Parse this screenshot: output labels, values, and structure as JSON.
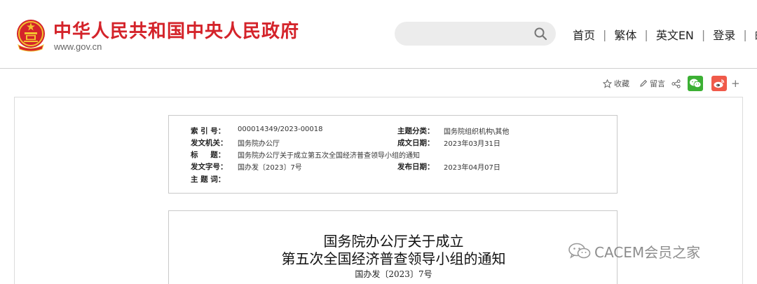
{
  "header": {
    "site_name": "中华人民共和国中央人民政府",
    "site_url": "www.gov.cn",
    "search": {
      "value": "",
      "placeholder": ""
    },
    "nav": [
      {
        "label": "首页"
      },
      {
        "label": "繁体"
      },
      {
        "label": "英文EN"
      },
      {
        "label": "登录"
      },
      {
        "label": "邮"
      }
    ],
    "nav_separator": "|"
  },
  "share": {
    "favorite_label": "收藏",
    "comment_label": "留言",
    "plus": "+"
  },
  "info": {
    "index_no": {
      "label": "索 引 号：",
      "value": "000014349/2023-00018"
    },
    "category": {
      "label": "主题分类：",
      "value": "国务院组织机构\\其他"
    },
    "issuer": {
      "label": "发文机关：",
      "value": "国务院办公厅"
    },
    "created": {
      "label": "成文日期：",
      "value": "2023年03月31日"
    },
    "title": {
      "label": "标 　 题：",
      "value": "国务院办公厅关于成立第五次全国经济普查领导小组的通知"
    },
    "doc_no": {
      "label": "发文字号：",
      "value": "国办发〔2023〕7号"
    },
    "published": {
      "label": "发布日期：",
      "value": "2023年04月07日"
    },
    "keywords": {
      "label": "主 题 词：",
      "value": ""
    }
  },
  "document": {
    "title_line1": "国务院办公厅关于成立",
    "title_line2": "第五次全国经济普查领导小组的通知",
    "doc_number": "国办发〔2023〕7号"
  },
  "watermark": {
    "text": "CACEM会员之家"
  },
  "colors": {
    "brand_red": "#d4232a",
    "wechat_green": "#3cb034",
    "weibo_red": "#f05a4a",
    "search_bg": "#ececec",
    "watermark_gray": "#8e8e8e"
  },
  "icons": {
    "emblem": "national-emblem-icon",
    "search": "search-icon",
    "favorite": "star-icon",
    "comment": "pencil-icon",
    "share": "share-icon",
    "wechat": "wechat-icon",
    "weibo": "weibo-icon",
    "watermark": "wechat-watermark-icon"
  }
}
